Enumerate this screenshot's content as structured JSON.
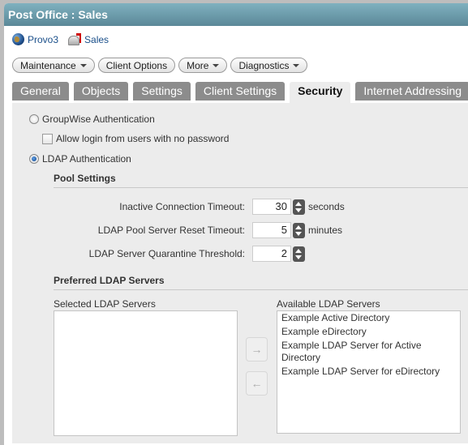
{
  "window": {
    "title": "Post Office : Sales"
  },
  "breadcrumb": [
    {
      "label": "Provo3",
      "icon": "globe-icon"
    },
    {
      "label": "Sales",
      "icon": "post-office-icon"
    }
  ],
  "actions": [
    {
      "label": "Maintenance",
      "dropdown": true
    },
    {
      "label": "Client Options",
      "dropdown": false
    },
    {
      "label": "More",
      "dropdown": true
    },
    {
      "label": "Diagnostics",
      "dropdown": true
    }
  ],
  "tabs": [
    {
      "label": "General",
      "active": false
    },
    {
      "label": "Objects",
      "active": false
    },
    {
      "label": "Settings",
      "active": false
    },
    {
      "label": "Client Settings",
      "active": false
    },
    {
      "label": "Security",
      "active": true
    },
    {
      "label": "Internet Addressing",
      "active": false
    }
  ],
  "auth": {
    "groupwise_label": "GroupWise Authentication",
    "groupwise_selected": false,
    "allow_no_password_label": "Allow login from users with no password",
    "allow_no_password_checked": false,
    "ldap_label": "LDAP Authentication",
    "ldap_selected": true
  },
  "pool": {
    "heading": "Pool Settings",
    "fields": [
      {
        "label": "Inactive Connection Timeout:",
        "value": "30",
        "unit": "seconds"
      },
      {
        "label": "LDAP Pool Server Reset Timeout:",
        "value": "5",
        "unit": "minutes"
      },
      {
        "label": "LDAP Server Quarantine Threshold:",
        "value": "2",
        "unit": ""
      }
    ]
  },
  "preferred": {
    "heading": "Preferred LDAP Servers",
    "selected_label": "Selected LDAP Servers",
    "selected_items": [],
    "available_label": "Available LDAP Servers",
    "available_items": [
      "Example Active Directory",
      "Example eDirectory",
      "Example LDAP Server for Active Directory",
      "Example LDAP Server for eDirectory"
    ],
    "add_glyph": "→",
    "remove_glyph": "←"
  }
}
